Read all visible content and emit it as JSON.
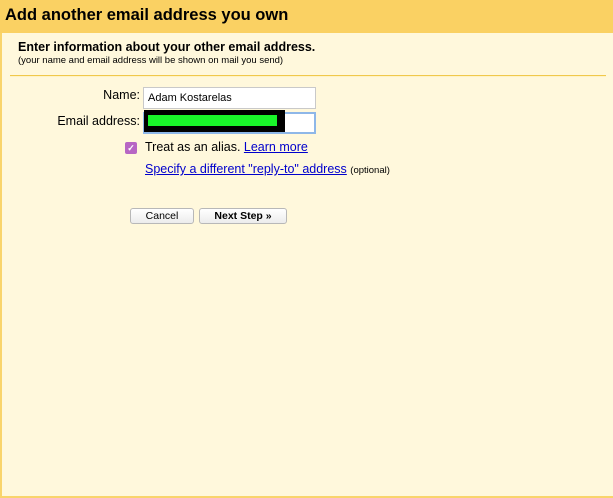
{
  "dialog": {
    "title": "Add another email address you own",
    "intro_title": "Enter information about your other email address.",
    "intro_subtitle": "(your name and email address will be shown on mail you send)"
  },
  "form": {
    "name_label": "Name:",
    "name_value": "Adam Kostarelas",
    "email_label": "Email address:",
    "email_value": "",
    "alias_checked": true,
    "alias_text": "Treat as an alias.",
    "learn_more": "Learn more",
    "reply_to_link": "Specify a different \"reply-to\" address",
    "reply_to_optional": "(optional)"
  },
  "buttons": {
    "cancel": "Cancel",
    "next": "Next Step »"
  },
  "colors": {
    "header_bg": "#fad163",
    "page_bg": "#fff8dc",
    "link": "#0000cc",
    "checkbox": "#b766c4",
    "redaction_outer": "#000000",
    "redaction_inner": "#19f52a"
  },
  "icons": {
    "checkbox": "checkmark-icon"
  }
}
